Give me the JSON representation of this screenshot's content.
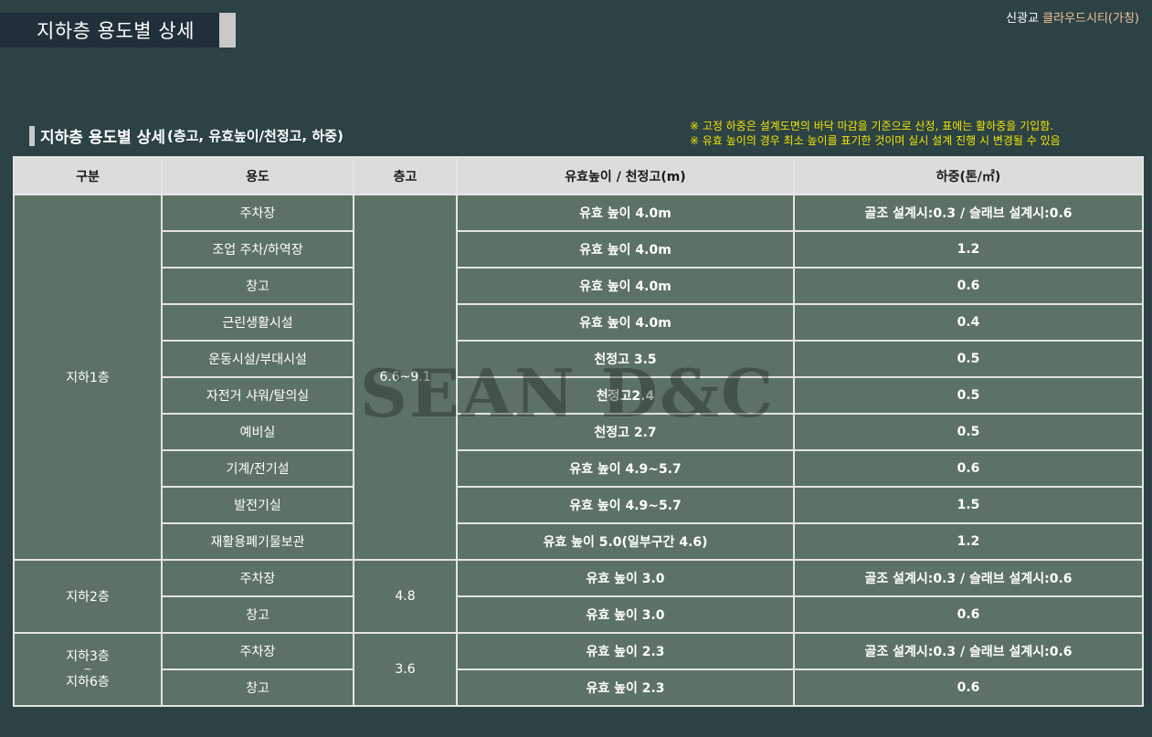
{
  "header": {
    "title": "지하층 용도별 상세",
    "brand_prefix": "신광교",
    "brand_name": "클라우드시티(가칭)"
  },
  "section": {
    "title": "지하층 용도별 상세",
    "subtitle": "(층고, 유효높이/천정고, 하중)"
  },
  "notes": [
    "※ 고정 하중은 설계도면의 바닥 마감을 기준으로 산정, 표에는 활하중을 기입함.",
    "※ 유효 높이의 경우 최소 높이를 표기한 것이며 실시 설계 진행 시 변경될 수 있음"
  ],
  "table": {
    "headers": [
      "구분",
      "용도",
      "층고",
      "유효높이 / 천정고(m)",
      "하중(톤/㎡)"
    ],
    "groups": [
      {
        "floor": "지하1층",
        "height": "6.6~9.1",
        "rows": [
          {
            "use": "주차장",
            "clear": "유효 높이 4.0m",
            "load": "골조 설계시:0.3 / 슬래브 설계시:0.6"
          },
          {
            "use": "조업 주차/하역장",
            "clear": "유효 높이 4.0m",
            "load": "1.2"
          },
          {
            "use": "창고",
            "clear": "유효 높이 4.0m",
            "load": "0.6"
          },
          {
            "use": "근린생활시설",
            "clear": "유효 높이 4.0m",
            "load": "0.4"
          },
          {
            "use": "운동시설/부대시설",
            "clear": "천정고 3.5",
            "load": "0.5"
          },
          {
            "use": "자전거 샤워/탈의실",
            "clear": "천정고2.4",
            "load": "0.5"
          },
          {
            "use": "예비실",
            "clear": "천정고 2.7",
            "load": "0.5"
          },
          {
            "use": "기계/전기설",
            "clear": "유효 높이 4.9~5.7",
            "load": "0.6"
          },
          {
            "use": "발전기실",
            "clear": "유효 높이 4.9~5.7",
            "load": "1.5"
          },
          {
            "use": "재활용폐기물보관",
            "clear": "유효 높이 5.0(일부구간 4.6)",
            "load": "1.2"
          }
        ]
      },
      {
        "floor": "지하2층",
        "height": "4.8",
        "rows": [
          {
            "use": "주차장",
            "clear": "유효 높이 3.0",
            "load": "골조 설계시:0.3 / 슬래브 설계시:0.6"
          },
          {
            "use": "창고",
            "clear": "유효 높이 3.0",
            "load": "0.6"
          }
        ]
      },
      {
        "floor_lines": [
          "지하3층",
          "~",
          "지하6층"
        ],
        "height": "3.6",
        "rows": [
          {
            "use": "주차장",
            "clear": "유효 높이 2.3",
            "load": "골조 설계시:0.3 / 슬래브 설계시:0.6"
          },
          {
            "use": "창고",
            "clear": "유효 높이 2.3",
            "load": "0.6"
          }
        ]
      }
    ]
  },
  "watermark": "SEAN D&C"
}
